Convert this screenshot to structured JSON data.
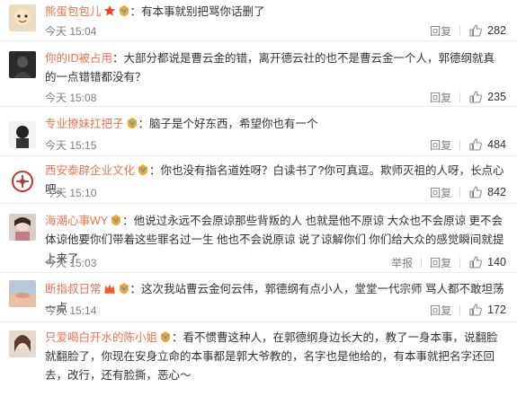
{
  "colors": {
    "username": "#eb7350",
    "text": "#333333",
    "meta": "#808080"
  },
  "comments": [
    {
      "user": "熊蛋包包儿",
      "badges": [
        "star-badge-icon",
        "membership-badge-icon"
      ],
      "text": "：有本事就别把骂你话删了",
      "time": "今天 15:04",
      "reply": "回复",
      "likes": "282"
    },
    {
      "user": "你的ID被占用",
      "badges": [],
      "text": "：大部分都说是曹云金的错，离开德云社的也不是曹云金一个人，郭德纲就真的一点错错都没有？",
      "time": "今天 15:08",
      "reply": "回复",
      "likes": "235"
    },
    {
      "user": "专业撩妹扛把子",
      "badges": [
        "membership-badge-icon"
      ],
      "text": "：脑子是个好东西，希望你也有一个",
      "time": "今天 15:15",
      "reply": "回复",
      "likes": "484"
    },
    {
      "user": "西安泰辟企业文化",
      "badges": [
        "membership-badge-icon"
      ],
      "text": "：你也没有指名道姓呀？白读书了?你可真逗。欺师灭祖的人呀，长点心吧。",
      "time": "今天 15:10",
      "reply": "回复",
      "likes": "842"
    },
    {
      "user": "海潮心事WY",
      "badges": [
        "membership-badge-icon"
      ],
      "text": "：他说过永远不会原谅那些背叛的人 也就是他不原谅 大众也不会原谅 更不会体谅他要你们带着这些罪名过一生 他也不会说原谅 说了谅解你们 你们给大众的感觉瞬间就提上来了",
      "time": "今天 15:03",
      "report": "举报",
      "reply": "回复",
      "likes": "140"
    },
    {
      "user": "断指叔日常",
      "badges": [
        "crown-badge-icon",
        "membership-badge-icon"
      ],
      "text": "：这次我站曹云金何云伟，郭德纲有点小人，堂堂一代宗师 骂人都不敢坦荡一点",
      "time": "今天 15:14",
      "reply": "回复",
      "likes": "172"
    },
    {
      "user": "只爱喝白开水的陈小姐",
      "badges": [
        "membership-badge-icon"
      ],
      "text": "：看不惯曹这种人，在郭德纲身边长大的，教了一身本事，说翻脸就翻脸了，你现在安身立命的本事都是郭大爷教的，名字也是他给的，有本事就把名字还回去，改行，还有脸撕，恶心～"
    }
  ]
}
